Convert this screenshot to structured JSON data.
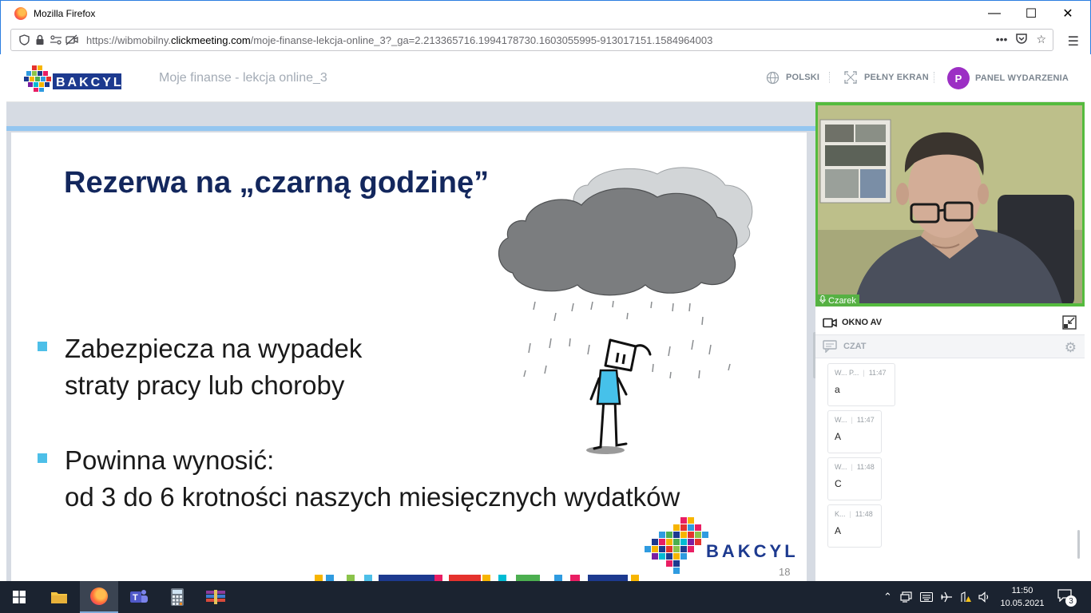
{
  "window": {
    "title": "Mozilla Firefox"
  },
  "browser": {
    "url_prefix": "https://wibmobilny.",
    "url_domain": "clickmeeting.com",
    "url_rest": "/moje-finanse-lekcja-online_3?_ga=2.213365716.1994178730.1603055995-913017151.1584964003"
  },
  "header": {
    "logo_text": "BAKCYL",
    "event_title": "Moje finanse - lekcja online_3",
    "language_label": "POLSKI",
    "fullscreen_label": "PEŁNY EKRAN",
    "panel_label": "PANEL WYDARZENIA",
    "avatar_letter": "P"
  },
  "slide": {
    "title": "Rezerwa na „czarną godzinę”",
    "bullets": [
      {
        "line1": "Zabezpiecza na wypadek",
        "line2": "straty pracy lub choroby"
      },
      {
        "line1": "Powinna wynosić:",
        "line2": "od 3 do 6 krotności naszych miesięcznych wydatków"
      }
    ],
    "logo_text": "BAKCYL",
    "page_number": "18"
  },
  "video": {
    "participant_name": "Czarek"
  },
  "av_window": {
    "label": "OKNO AV"
  },
  "chat": {
    "label": "CZAT",
    "messages": [
      {
        "sender": "W... P...",
        "time": "11:47",
        "text": "a"
      },
      {
        "sender": "W...",
        "time": "11:47",
        "text": "A"
      },
      {
        "sender": "W...",
        "time": "11:48",
        "text": "C"
      },
      {
        "sender": "K...",
        "time": "11:48",
        "text": "A"
      }
    ]
  },
  "taskbar": {
    "time": "11:50",
    "date": "10.05.2021",
    "notification_count": "3"
  },
  "colors": {
    "slide_title": "#13275d",
    "bullet": "#4dbfe8",
    "avatar": "#9c2fc4",
    "speaker_frame": "#55bb3e",
    "taskbar": "#1b2330"
  }
}
